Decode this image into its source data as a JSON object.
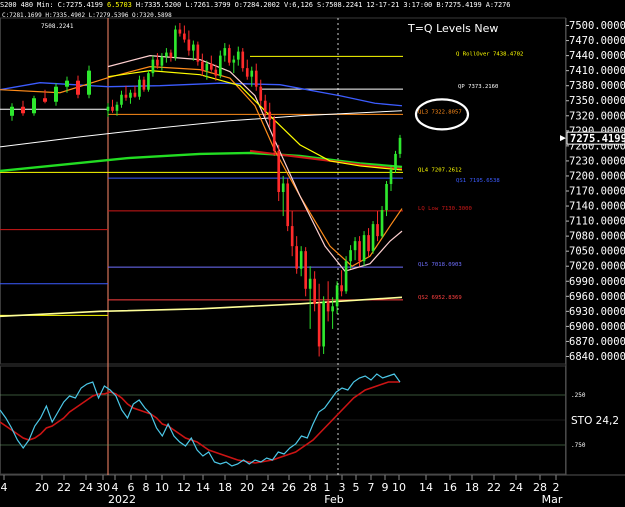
{
  "header": {
    "symbol": "S200",
    "interval": "480 Min",
    "close": "C:7275.4199",
    "change": "6.5703",
    "high": "H:7335.5200",
    "low": "L:7261.3799",
    "open": "O:7284.2002",
    "volume": "V:6,126",
    "stat": "S:7508.2241",
    "datetime": "12-17-21 3:17:00",
    "bar": "B:7275.4199",
    "ask": "A:7276"
  },
  "sub_header": {
    "left_values": "C:7281.1699 H:7335.4902 L:7279.5396 O:7320.5898",
    "ref_price": "7508.2241"
  },
  "chart_data": {
    "type": "candlestick",
    "title": "T=Q Levels New",
    "y_axis": {
      "min": 6825,
      "max": 7515,
      "position": "right",
      "ticks": [
        "7500.0000",
        "7470.0000",
        "7440.0000",
        "7410.0000",
        "7380.0000",
        "7350.0000",
        "7320.0000",
        "7290.0000",
        "7260.0000",
        "7230.0000",
        "7200.0000",
        "7170.0000",
        "7140.0000",
        "7110.0000",
        "7080.0000",
        "7050.0000",
        "7020.0000",
        "6990.0000",
        "6960.0000",
        "6930.0000",
        "6900.0000",
        "6870.0000",
        "6840.0000"
      ]
    },
    "last_price_label": "7275.4199",
    "x_axis": {
      "day_labels": [
        "4",
        "20",
        "22",
        "24",
        "30",
        "4",
        "6",
        "8",
        "10",
        "12",
        "14",
        "18",
        "20",
        "24",
        "26",
        "28",
        "1",
        "3",
        "5",
        "7",
        "9",
        "10",
        "14",
        "16",
        "18",
        "22",
        "24",
        "28",
        "2"
      ],
      "month_labels": [
        "2022",
        "Feb",
        "Mar"
      ]
    },
    "candles": [
      {
        "o": 7330,
        "h": 7345,
        "l": 7318,
        "c": 7338
      },
      {
        "o": 7338,
        "h": 7352,
        "l": 7326,
        "c": 7330
      },
      {
        "o": 7330,
        "h": 7348,
        "l": 7320,
        "c": 7342
      },
      {
        "o": 7342,
        "h": 7370,
        "l": 7336,
        "c": 7362
      },
      {
        "o": 7362,
        "h": 7380,
        "l": 7350,
        "c": 7356
      },
      {
        "o": 7356,
        "h": 7372,
        "l": 7344,
        "c": 7366
      },
      {
        "o": 7366,
        "h": 7380,
        "l": 7356,
        "c": 7358
      },
      {
        "o": 7358,
        "h": 7400,
        "l": 7352,
        "c": 7392
      },
      {
        "o": 7392,
        "h": 7398,
        "l": 7368,
        "c": 7372
      },
      {
        "o": 7372,
        "h": 7410,
        "l": 7368,
        "c": 7405
      },
      {
        "o": 7405,
        "h": 7440,
        "l": 7398,
        "c": 7432
      },
      {
        "o": 7432,
        "h": 7445,
        "l": 7414,
        "c": 7420
      },
      {
        "o": 7420,
        "h": 7445,
        "l": 7410,
        "c": 7438
      },
      {
        "o": 7438,
        "h": 7455,
        "l": 7426,
        "c": 7446
      },
      {
        "o": 7446,
        "h": 7452,
        "l": 7428,
        "c": 7436
      },
      {
        "o": 7436,
        "h": 7500,
        "l": 7430,
        "c": 7492
      },
      {
        "o": 7492,
        "h": 7505,
        "l": 7478,
        "c": 7484
      },
      {
        "o": 7484,
        "h": 7500,
        "l": 7466,
        "c": 7472
      },
      {
        "o": 7472,
        "h": 7490,
        "l": 7440,
        "c": 7450
      },
      {
        "o": 7450,
        "h": 7470,
        "l": 7430,
        "c": 7462
      },
      {
        "o": 7462,
        "h": 7468,
        "l": 7420,
        "c": 7428
      },
      {
        "o": 7428,
        "h": 7444,
        "l": 7400,
        "c": 7410
      },
      {
        "o": 7410,
        "h": 7430,
        "l": 7392,
        "c": 7424
      },
      {
        "o": 7424,
        "h": 7440,
        "l": 7408,
        "c": 7412
      },
      {
        "o": 7412,
        "h": 7422,
        "l": 7390,
        "c": 7400
      },
      {
        "o": 7400,
        "h": 7450,
        "l": 7395,
        "c": 7440
      },
      {
        "o": 7440,
        "h": 7465,
        "l": 7428,
        "c": 7455
      },
      {
        "o": 7455,
        "h": 7462,
        "l": 7420,
        "c": 7426
      },
      {
        "o": 7426,
        "h": 7440,
        "l": 7405,
        "c": 7432
      },
      {
        "o": 7432,
        "h": 7458,
        "l": 7420,
        "c": 7448
      },
      {
        "o": 7448,
        "h": 7455,
        "l": 7408,
        "c": 7415
      },
      {
        "o": 7415,
        "h": 7432,
        "l": 7392,
        "c": 7398
      },
      {
        "o": 7398,
        "h": 7418,
        "l": 7378,
        "c": 7410
      },
      {
        "o": 7410,
        "h": 7424,
        "l": 7370,
        "c": 7378
      },
      {
        "o": 7378,
        "h": 7392,
        "l": 7340,
        "c": 7350
      },
      {
        "o": 7350,
        "h": 7362,
        "l": 7318,
        "c": 7328
      },
      {
        "o": 7328,
        "h": 7346,
        "l": 7298,
        "c": 7312
      },
      {
        "o": 7312,
        "h": 7320,
        "l": 7240,
        "c": 7250
      },
      {
        "o": 7250,
        "h": 7262,
        "l": 7150,
        "c": 7168
      },
      {
        "o": 7168,
        "h": 7200,
        "l": 7120,
        "c": 7185
      },
      {
        "o": 7185,
        "h": 7195,
        "l": 7090,
        "c": 7100
      },
      {
        "o": 7100,
        "h": 7130,
        "l": 7040,
        "c": 7060
      },
      {
        "o": 7060,
        "h": 7080,
        "l": 7005,
        "c": 7015
      },
      {
        "o": 7015,
        "h": 7060,
        "l": 7000,
        "c": 7050
      },
      {
        "o": 7050,
        "h": 7058,
        "l": 6960,
        "c": 6975
      },
      {
        "o": 6975,
        "h": 7020,
        "l": 6895,
        "c": 6995
      },
      {
        "o": 6995,
        "h": 7010,
        "l": 6930,
        "c": 6945
      },
      {
        "o": 6945,
        "h": 6985,
        "l": 6840,
        "c": 6860
      },
      {
        "o": 6860,
        "h": 6960,
        "l": 6845,
        "c": 6950
      },
      {
        "o": 6950,
        "h": 6990,
        "l": 6910,
        "c": 6930
      },
      {
        "o": 6930,
        "h": 6958,
        "l": 6895,
        "c": 6940
      },
      {
        "o": 6940,
        "h": 6990,
        "l": 6925,
        "c": 6982
      },
      {
        "o": 6982,
        "h": 7012,
        "l": 6960,
        "c": 6970
      },
      {
        "o": 6970,
        "h": 7040,
        "l": 6965,
        "c": 7030
      },
      {
        "o": 7030,
        "h": 7062,
        "l": 7015,
        "c": 7052
      },
      {
        "o": 7052,
        "h": 7078,
        "l": 7032,
        "c": 7070
      },
      {
        "o": 7070,
        "h": 7080,
        "l": 7020,
        "c": 7030
      },
      {
        "o": 7030,
        "h": 7090,
        "l": 7020,
        "c": 7082
      },
      {
        "o": 7082,
        "h": 7096,
        "l": 7040,
        "c": 7050
      },
      {
        "o": 7050,
        "h": 7110,
        "l": 7045,
        "c": 7104
      },
      {
        "o": 7104,
        "h": 7130,
        "l": 7070,
        "c": 7080
      },
      {
        "o": 7080,
        "h": 7140,
        "l": 7076,
        "c": 7132
      },
      {
        "o": 7132,
        "h": 7190,
        "l": 7120,
        "c": 7184
      },
      {
        "o": 7184,
        "h": 7222,
        "l": 7170,
        "c": 7212
      },
      {
        "o": 7212,
        "h": 7250,
        "l": 7206,
        "c": 7244
      },
      {
        "o": 7244,
        "h": 7282,
        "l": 7236,
        "c": 7276
      }
    ],
    "levels": [
      {
        "label": "Q RollOver 7438.4702",
        "value": 7438.47,
        "color": "#ffff00"
      },
      {
        "label": "QP 7373.2160",
        "value": 7373.22,
        "color": "#ffffff"
      },
      {
        "label": "QL3 7322.8057",
        "value": 7322.81,
        "color": "#ff8c1a"
      },
      {
        "label": "QL4 7207.2612",
        "value": 7207.26,
        "color": "#ffff00"
      },
      {
        "label": "QS1 7195.6538",
        "value": 7195.65,
        "color": "#3c5cff"
      },
      {
        "label": "LQ Low 7130.3000",
        "value": 7130.3,
        "color": "#d01818"
      },
      {
        "label": "QL5 7018.0903",
        "value": 7018.09,
        "color": "#6f6fff"
      },
      {
        "label": "QS2 6952.8369",
        "value": 6952.84,
        "color": "#ff4040"
      }
    ],
    "highlight_level": "QL3 7322.8057",
    "stochastic": {
      "label": "STO",
      "params": "24,2",
      "ticks": [
        ".250",
        ".750"
      ],
      "k": [
        60,
        52,
        42,
        30,
        22,
        30,
        44,
        52,
        64,
        48,
        58,
        68,
        74,
        72,
        82,
        86,
        88,
        72,
        84,
        80,
        74,
        60,
        52,
        66,
        70,
        62,
        56,
        42,
        34,
        46,
        34,
        28,
        24,
        32,
        20,
        14,
        18,
        8,
        6,
        8,
        4,
        6,
        10,
        6,
        10,
        8,
        12,
        10,
        18,
        16,
        22,
        26,
        34,
        32,
        46,
        58,
        62,
        70,
        78,
        82,
        80,
        88,
        92,
        94,
        90,
        96,
        92,
        94,
        96,
        88
      ],
      "d": [
        48,
        44,
        40,
        36,
        32,
        30,
        32,
        36,
        42,
        44,
        48,
        52,
        58,
        62,
        66,
        70,
        74,
        76,
        76,
        78,
        76,
        72,
        66,
        62,
        60,
        58,
        56,
        52,
        46,
        44,
        40,
        36,
        32,
        30,
        28,
        24,
        20,
        18,
        16,
        14,
        12,
        10,
        9,
        8,
        7,
        8,
        9,
        10,
        12,
        14,
        16,
        18,
        22,
        26,
        30,
        36,
        42,
        48,
        54,
        60,
        66,
        72,
        76,
        80,
        82,
        84,
        86,
        88,
        88,
        88
      ]
    }
  }
}
